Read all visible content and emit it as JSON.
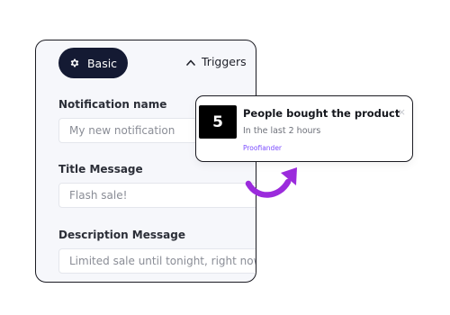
{
  "tabs": {
    "basic": {
      "label": "Basic",
      "icon": "gear-icon",
      "active": true
    },
    "triggers": {
      "label": "Triggers",
      "icon": "chevron-up-icon"
    }
  },
  "fields": [
    {
      "label": "Notification name",
      "placeholder": "My new notification",
      "value": ""
    },
    {
      "label": "Title Message",
      "placeholder": "Flash sale!",
      "value": ""
    },
    {
      "label": "Description Message",
      "placeholder": "Limited sale until tonight, right now!",
      "value": ""
    }
  ],
  "notification": {
    "count": "5",
    "title": "People bought the product",
    "subtitle": "In the last 2 hours",
    "brand": "Proofiander",
    "close": "×"
  },
  "colors": {
    "tab_active_bg": "#141a33",
    "panel_bg": "#f6f7fb",
    "brand_text": "#7c4dff",
    "arrow": "#9b2bdc"
  }
}
